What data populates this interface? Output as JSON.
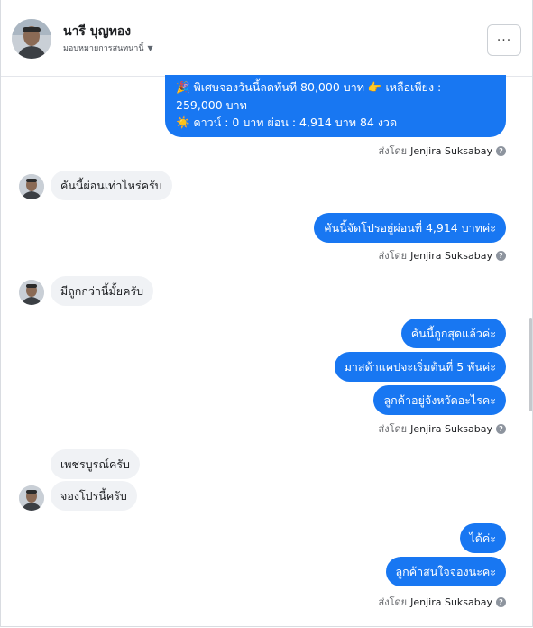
{
  "header": {
    "name": "นารี บุญทอง",
    "assign_label": "มอบหมายการสนทนานี้",
    "more_label": "···"
  },
  "thread": {
    "promo_lines": [
      "🎉 พิเศษจองวันนี้ลดทันที 80,000 บาท 👉 เหลือเพียง :",
      "259,000 บาท",
      "☀️ ดาวน์ : 0 บาท ผ่อน : 4,914 บาท 84 งวด"
    ],
    "sent_by_prefix": "ส่งโดย",
    "sent_by_name": "Jenjira Suksabay",
    "help_glyph": "?",
    "messages": [
      {
        "from": "customer",
        "text": "คันนี้ผ่อนเท่าไหร่ครับ"
      },
      {
        "from": "page",
        "text": "คันนี้จัดโปรอยู่ผ่อนที่ 4,914 บาทค่ะ"
      },
      {
        "from": "customer",
        "text": "มีถูกกว่านี้มั้ยครับ"
      },
      {
        "from": "page",
        "text": "คันนี้ถูกสุดแล้วค่ะ"
      },
      {
        "from": "page",
        "text": "มาสด้าแคปจะเริ่มต้นที่ 5 พันค่ะ"
      },
      {
        "from": "page",
        "text": "ลูกค้าอยู่จังหวัดอะไรคะ"
      },
      {
        "from": "customer",
        "text": "เพชรบูรณ์ครับ"
      },
      {
        "from": "customer",
        "text": "จองโปรนี้ครับ"
      },
      {
        "from": "page",
        "text": "ได้ค่ะ"
      },
      {
        "from": "page",
        "text": "ลูกค้าสนใจจองนะคะ"
      }
    ]
  },
  "colors": {
    "outgoing_bubble": "#1877f2",
    "incoming_bubble": "#f0f2f5"
  },
  "icons": [
    "avatar-photo",
    "caret-down-icon",
    "more-icon",
    "help-circle-icon"
  ]
}
